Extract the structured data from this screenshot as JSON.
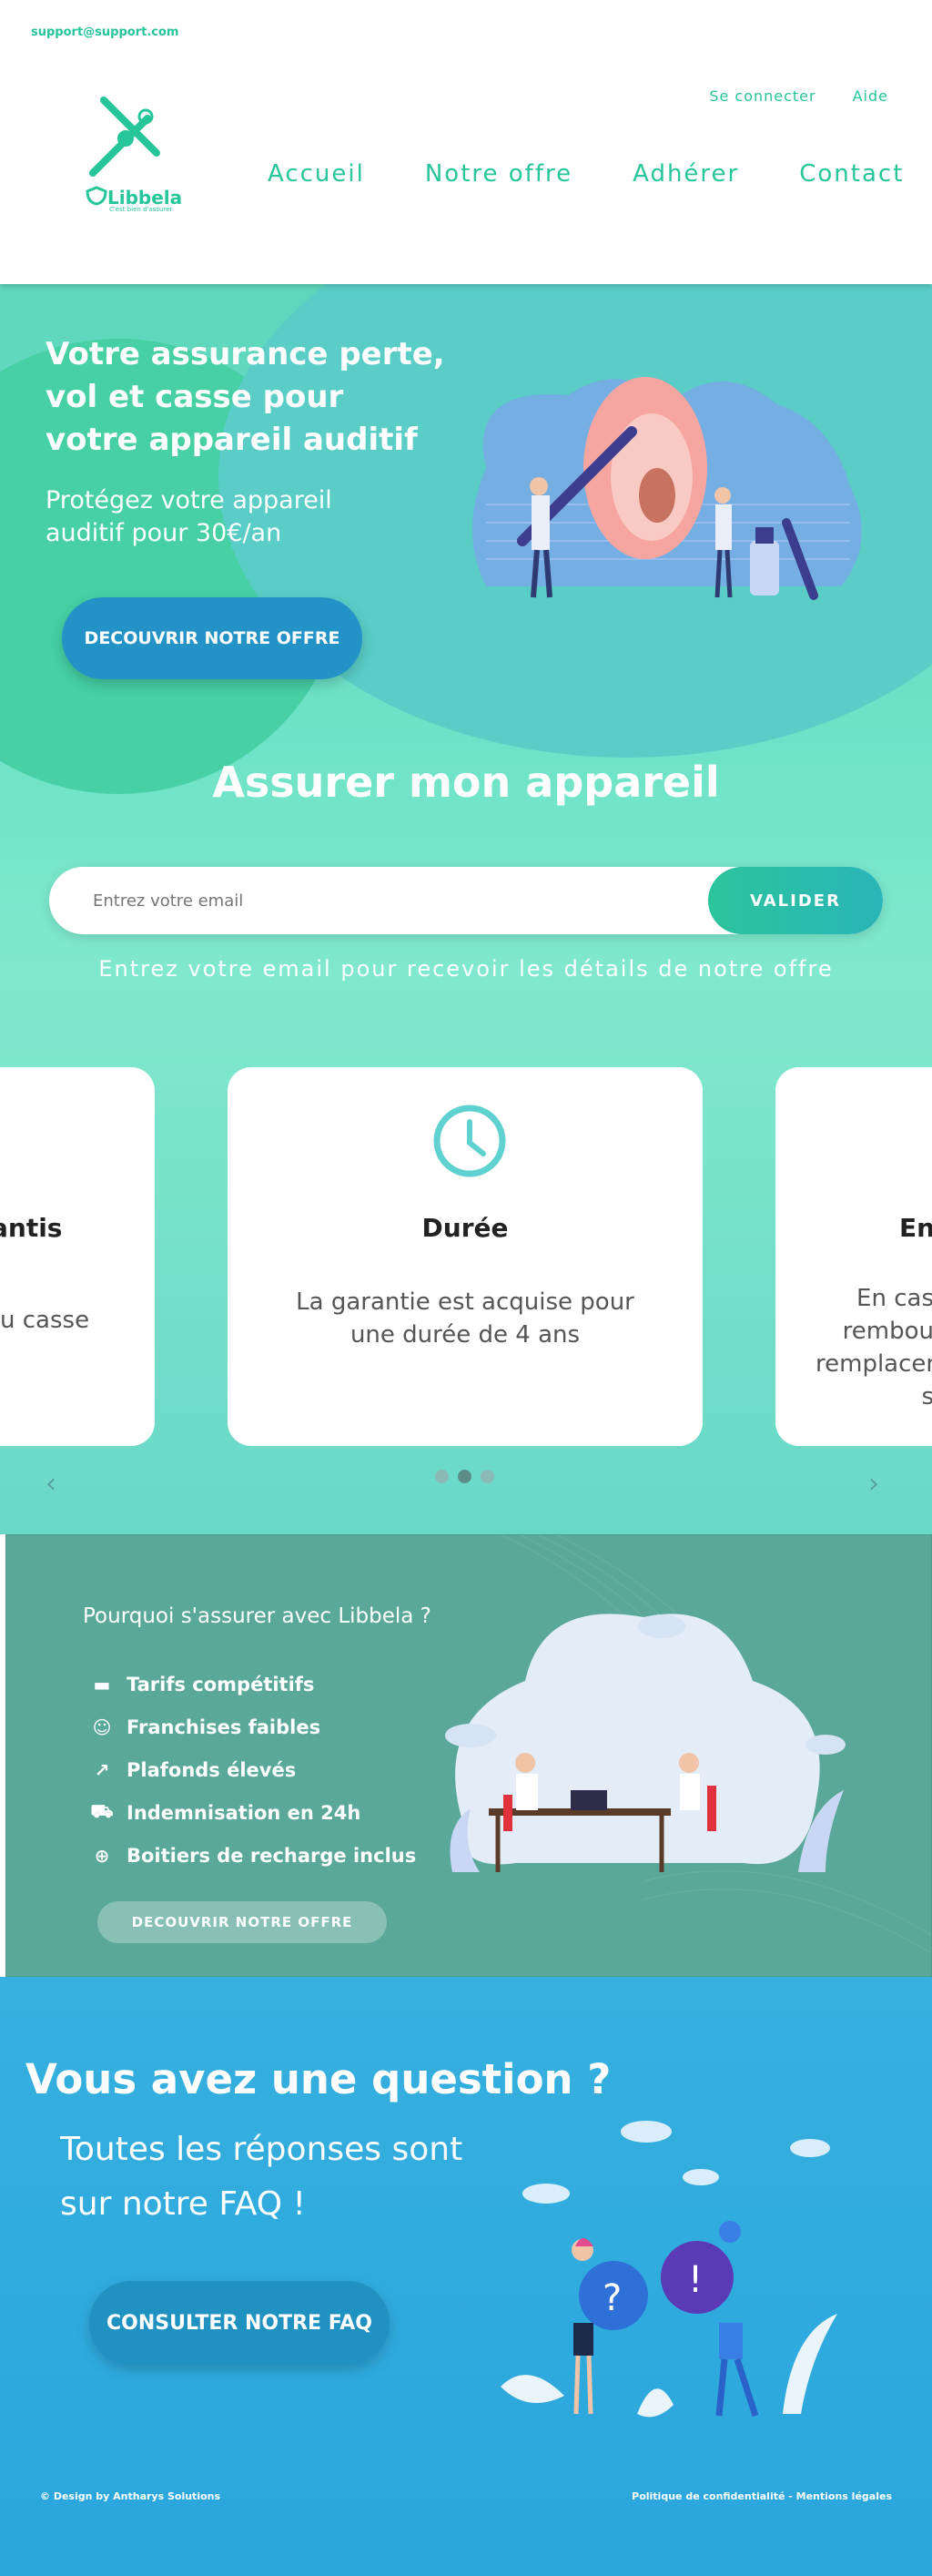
{
  "header": {
    "support_email": "support@support.com",
    "logo_name": "Libbela",
    "logo_tagline": "C'est bien d'assurer",
    "top_links": [
      "Se connecter",
      "Aide"
    ],
    "nav": [
      "Accueil",
      "Notre offre",
      "Adhérer",
      "Contact"
    ]
  },
  "hero": {
    "title": "Votre assurance perte, vol et casse pour votre appareil auditif",
    "subtitle": "Protégez votre appareil auditif pour 30€/an",
    "cta": "DECOUVRIR NOTRE OFFRE"
  },
  "assurer": {
    "title": "Assurer mon appareil",
    "email_placeholder": "Entrez votre email",
    "submit": "VALIDER",
    "hint": "Entrez votre email pour recevoir les détails de notre offre"
  },
  "carousel": {
    "cards": [
      {
        "title": "antis",
        "text": "u casse"
      },
      {
        "title": "Durée",
        "text": "La garantie est acquise pour une durée de 4 ans"
      },
      {
        "title": "En",
        "text": "En cas rembou remplacem s"
      }
    ],
    "dots": 3,
    "active_dot": 1
  },
  "why": {
    "title": "Pourquoi s'assurer avec Libbela ?",
    "items": [
      {
        "icon": "money-icon",
        "label": "Tarifs compétitifs"
      },
      {
        "icon": "smile-icon",
        "label": "Franchises faibles"
      },
      {
        "icon": "chart-icon",
        "label": "Plafonds élevés"
      },
      {
        "icon": "truck-icon",
        "label": "Indemnisation en 24h"
      },
      {
        "icon": "plus-circle-icon",
        "label": "Boitiers de recharge inclus"
      }
    ],
    "cta": "DECOUVRIR NOTRE OFFRE"
  },
  "faq": {
    "title": "Vous avez une question ?",
    "subtitle_line1": "Toutes les réponses sont",
    "subtitle_line2": "sur notre FAQ !",
    "cta": "CONSULTER NOTRE FAQ"
  },
  "footer": {
    "credit": "© Design by Antharys Solutions",
    "links": "Politique de confidentialité  -  Mentions légales"
  },
  "colors": {
    "brand_green": "#27c59a",
    "hero_blue_button": "#2393c7",
    "why_bg": "#5aa899",
    "faq_bg": "#2aa6dd"
  }
}
